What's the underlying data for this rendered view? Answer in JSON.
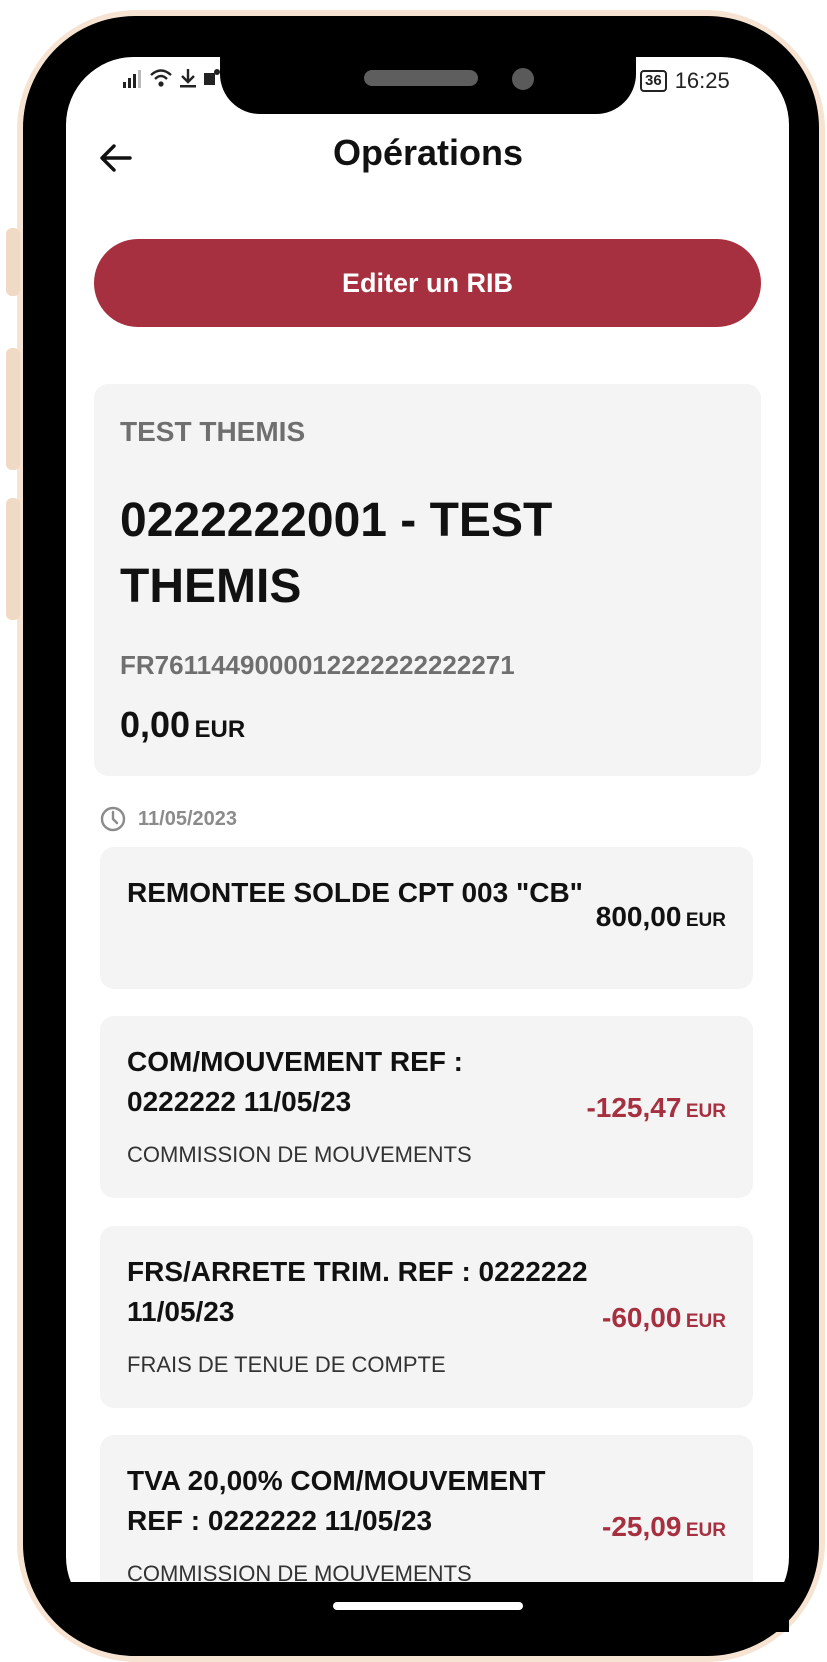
{
  "status_bar": {
    "battery": "36",
    "time": "16:25"
  },
  "header": {
    "title": "Opérations"
  },
  "rib_button": {
    "label": "Editer un RIB"
  },
  "account": {
    "holder": "TEST THEMIS",
    "number": "0222222001 - TEST THEMIS",
    "iban": "FR7611449000012222222222271",
    "balance": "0,00",
    "currency": "EUR"
  },
  "date_group": {
    "date": "11/05/2023"
  },
  "operations": [
    {
      "title": "REMONTEE SOLDE CPT 003 \"CB\"",
      "subtitle": "",
      "amount": "800,00",
      "currency": "EUR"
    },
    {
      "title": "COM/MOUVEMENT REF : 0222222 11/05/23",
      "subtitle": "COMMISSION DE MOUVEMENTS",
      "amount": "-125,47",
      "currency": "EUR"
    },
    {
      "title": "FRS/ARRETE TRIM. REF : 0222222 11/05/23",
      "subtitle": "FRAIS DE TENUE DE COMPTE",
      "amount": "-60,00",
      "currency": "EUR"
    },
    {
      "title": "TVA 20,00% COM/MOUVEMENT REF : 0222222 11/05/23",
      "subtitle": "COMMISSION DE MOUVEMENTS",
      "amount": "-25,09",
      "currency": "EUR"
    }
  ],
  "colors": {
    "accent": "#a6303f",
    "card_bg": "#f4f4f4",
    "frame": "#f7e3d2"
  }
}
